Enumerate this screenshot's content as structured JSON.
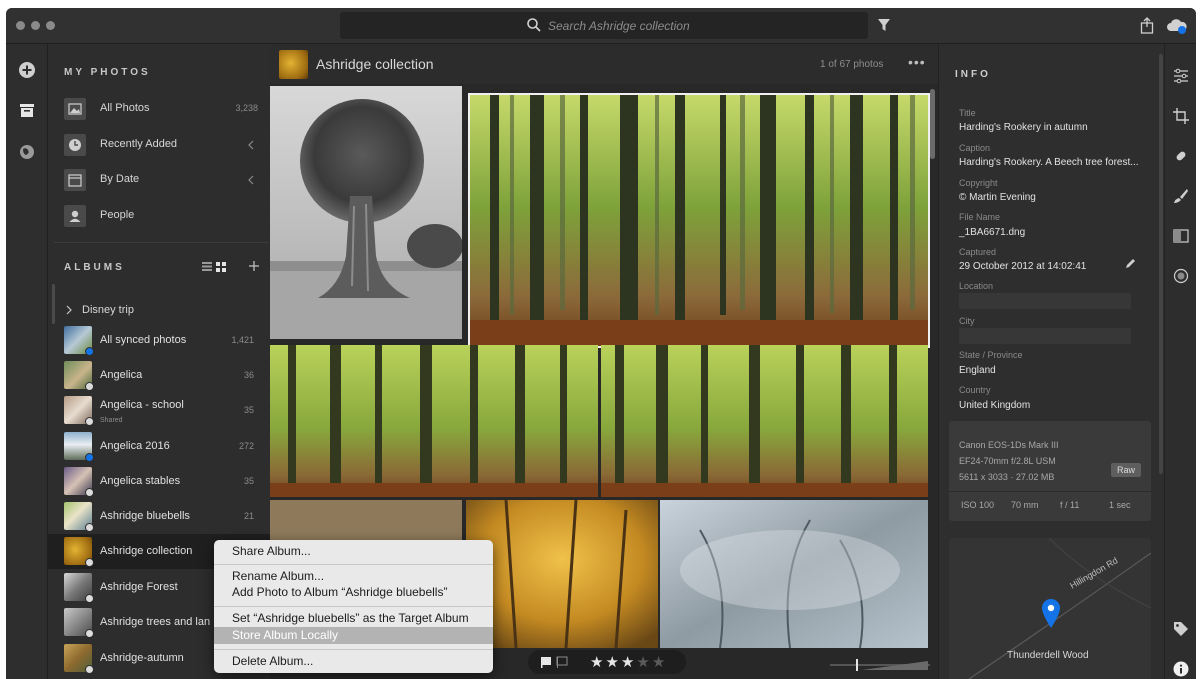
{
  "titlebar": {
    "search_placeholder": "Search Ashridge collection"
  },
  "sidebar": {
    "my_photos_title": "MY PHOTOS",
    "nav": [
      {
        "label": "All Photos",
        "count": "3,238",
        "icon": "photos-icon"
      },
      {
        "label": "Recently Added",
        "count": "",
        "icon": "clock-icon"
      },
      {
        "label": "By Date",
        "count": "",
        "icon": "calendar-icon"
      },
      {
        "label": "People",
        "count": "",
        "icon": "person-icon"
      }
    ],
    "albums_title": "ALBUMS",
    "folder": "Disney trip",
    "albums": [
      {
        "label": "All synced photos",
        "count": "1,421",
        "sub": ""
      },
      {
        "label": "Angelica",
        "count": "36",
        "sub": ""
      },
      {
        "label": "Angelica - school",
        "count": "35",
        "sub": "Shared"
      },
      {
        "label": "Angelica 2016",
        "count": "272",
        "sub": ""
      },
      {
        "label": "Angelica stables",
        "count": "35",
        "sub": ""
      },
      {
        "label": "Ashridge bluebells",
        "count": "21",
        "sub": ""
      },
      {
        "label": "Ashridge collection",
        "count": "",
        "sub": ""
      },
      {
        "label": "Ashridge Forest",
        "count": "",
        "sub": ""
      },
      {
        "label": "Ashridge trees and lan",
        "count": "",
        "sub": ""
      },
      {
        "label": "Ashridge-autumn",
        "count": "",
        "sub": ""
      }
    ]
  },
  "main": {
    "title": "Ashridge collection",
    "count": "1 of 67 photos",
    "more": "•••"
  },
  "context_menu": {
    "items": [
      "Share Album...",
      "Rename Album...",
      "Add Photo to Album “Ashridge bluebells”",
      "Set “Ashridge bluebells” as the Target Album",
      "Store Album Locally",
      "Delete Album..."
    ]
  },
  "info": {
    "heading": "INFO",
    "title_label": "Title",
    "title_value": "Harding's Rookery in autumn",
    "caption_label": "Caption",
    "caption_value": "Harding's Rookery. A Beech tree forest...",
    "copyright_label": "Copyright",
    "copyright_value": "© Martin Evening",
    "filename_label": "File Name",
    "filename_value": "_1BA6671.dng",
    "captured_label": "Captured",
    "captured_value": "29 October 2012 at 14:02:41",
    "location_label": "Location",
    "city_label": "City",
    "state_label": "State / Province",
    "state_value": "England",
    "country_label": "Country",
    "country_value": "United Kingdom",
    "camera": "Canon EOS-1Ds Mark III",
    "lens": "EF24-70mm f/2.8L USM",
    "dims": "5611 x 3033  ·  27.02 MB",
    "raw": "Raw",
    "iso": "ISO 100",
    "focal": "70 mm",
    "aperture": "f / 11",
    "shutter": "1 sec",
    "map_road": "Hillingdon Rd",
    "map_place": "Thunderdell Wood"
  },
  "rating": {
    "stars": 3,
    "max": 5
  },
  "colors": {
    "accent": "#1473e6",
    "selection": "#1f1f1f"
  }
}
